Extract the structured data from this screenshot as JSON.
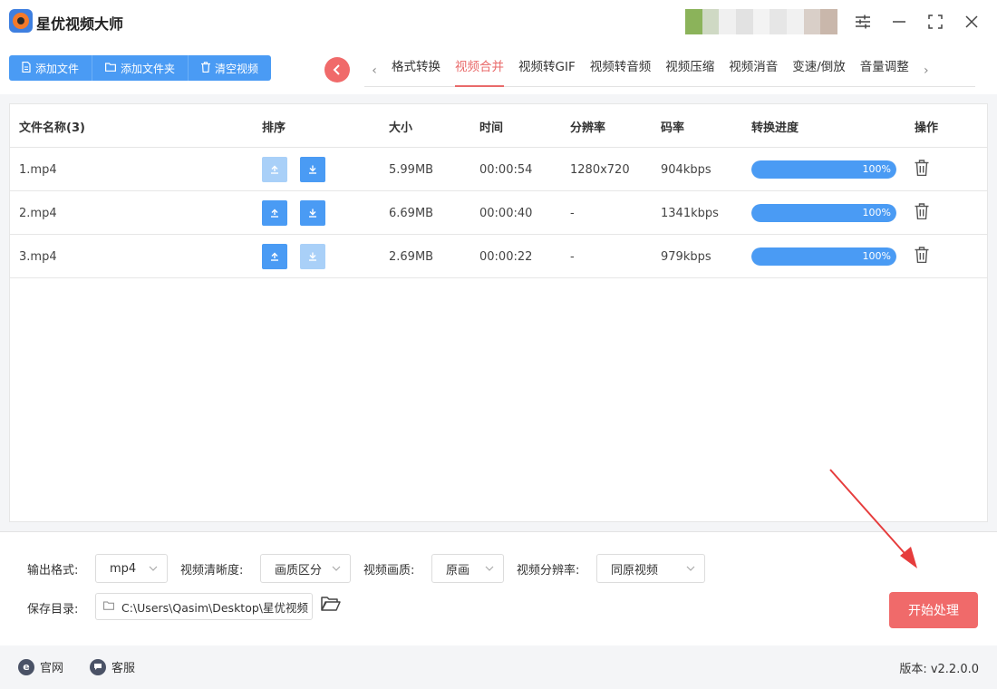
{
  "app": {
    "title": "星优视频大师"
  },
  "toolbar": {
    "add_file": "添加文件",
    "add_folder": "添加文件夹",
    "clear_videos": "清空视频"
  },
  "tabs": [
    {
      "label": "格式转换",
      "active": false
    },
    {
      "label": "视频合并",
      "active": true
    },
    {
      "label": "视频转GIF",
      "active": false
    },
    {
      "label": "视频转音频",
      "active": false
    },
    {
      "label": "视频压缩",
      "active": false
    },
    {
      "label": "视频消音",
      "active": false
    },
    {
      "label": "变速/倒放",
      "active": false
    },
    {
      "label": "音量调整",
      "active": false
    }
  ],
  "table": {
    "headers": {
      "name": "文件名称(3)",
      "sort": "排序",
      "size": "大小",
      "time": "时间",
      "resolution": "分辨率",
      "bitrate": "码率",
      "progress": "转换进度",
      "action": "操作"
    },
    "rows": [
      {
        "name": "1.mp4",
        "size": "5.99MB",
        "time": "00:00:54",
        "resolution": "1280x720",
        "bitrate": "904kbps",
        "progress": 100,
        "progress_label": "100%",
        "up_enabled": false,
        "down_enabled": true
      },
      {
        "name": "2.mp4",
        "size": "6.69MB",
        "time": "00:00:40",
        "resolution": "-",
        "bitrate": "1341kbps",
        "progress": 100,
        "progress_label": "100%",
        "up_enabled": true,
        "down_enabled": true
      },
      {
        "name": "3.mp4",
        "size": "2.69MB",
        "time": "00:00:22",
        "resolution": "-",
        "bitrate": "979kbps",
        "progress": 100,
        "progress_label": "100%",
        "up_enabled": true,
        "down_enabled": false
      }
    ]
  },
  "settings": {
    "output_format_label": "输出格式:",
    "output_format_value": "mp4",
    "clarity_label": "视频清晰度:",
    "clarity_value": "画质区分",
    "quality_label": "视频画质:",
    "quality_value": "原画",
    "resolution_label": "视频分辨率:",
    "resolution_value": "同原视频",
    "save_dir_label": "保存目录:",
    "save_dir_value": "C:\\Users\\Qasim\\Desktop\\星优视频",
    "start_button": "开始处理"
  },
  "footer": {
    "website": "官网",
    "support": "客服",
    "version": "版本: v2.2.0.0"
  },
  "colors": {
    "primary": "#4a9bf4",
    "accent": "#f06a6a",
    "annotation_arrow": "#e63c3c"
  }
}
